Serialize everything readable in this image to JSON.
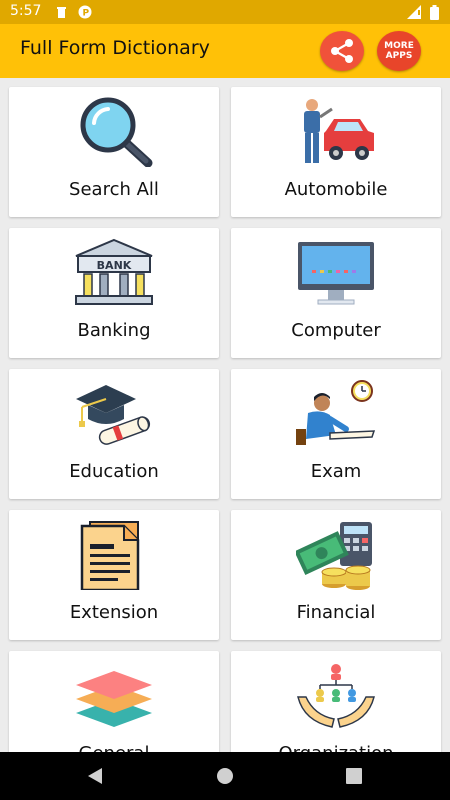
{
  "status_bar": {
    "time": "5:57"
  },
  "app_bar": {
    "title": "Full Form Dictionary",
    "more_apps_line1": "MORE",
    "more_apps_line2": "APPS"
  },
  "categories": [
    {
      "label": "Search All",
      "icon": "magnifier-icon"
    },
    {
      "label": "Automobile",
      "icon": "mechanic-car-icon"
    },
    {
      "label": "Banking",
      "icon": "bank-building-icon"
    },
    {
      "label": "Computer",
      "icon": "computer-monitor-icon"
    },
    {
      "label": "Education",
      "icon": "graduation-cap-icon"
    },
    {
      "label": "Exam",
      "icon": "student-writing-icon"
    },
    {
      "label": "Extension",
      "icon": "document-icon"
    },
    {
      "label": "Financial",
      "icon": "money-calculator-icon"
    },
    {
      "label": "General",
      "icon": "layers-icon"
    },
    {
      "label": "Organization",
      "icon": "organization-hands-icon"
    }
  ],
  "colors": {
    "status_bar": "#e0a800",
    "app_bar": "#ffc107",
    "share_button": "#f0523a",
    "more_apps_button": "#e8452a",
    "background": "#ececec"
  }
}
